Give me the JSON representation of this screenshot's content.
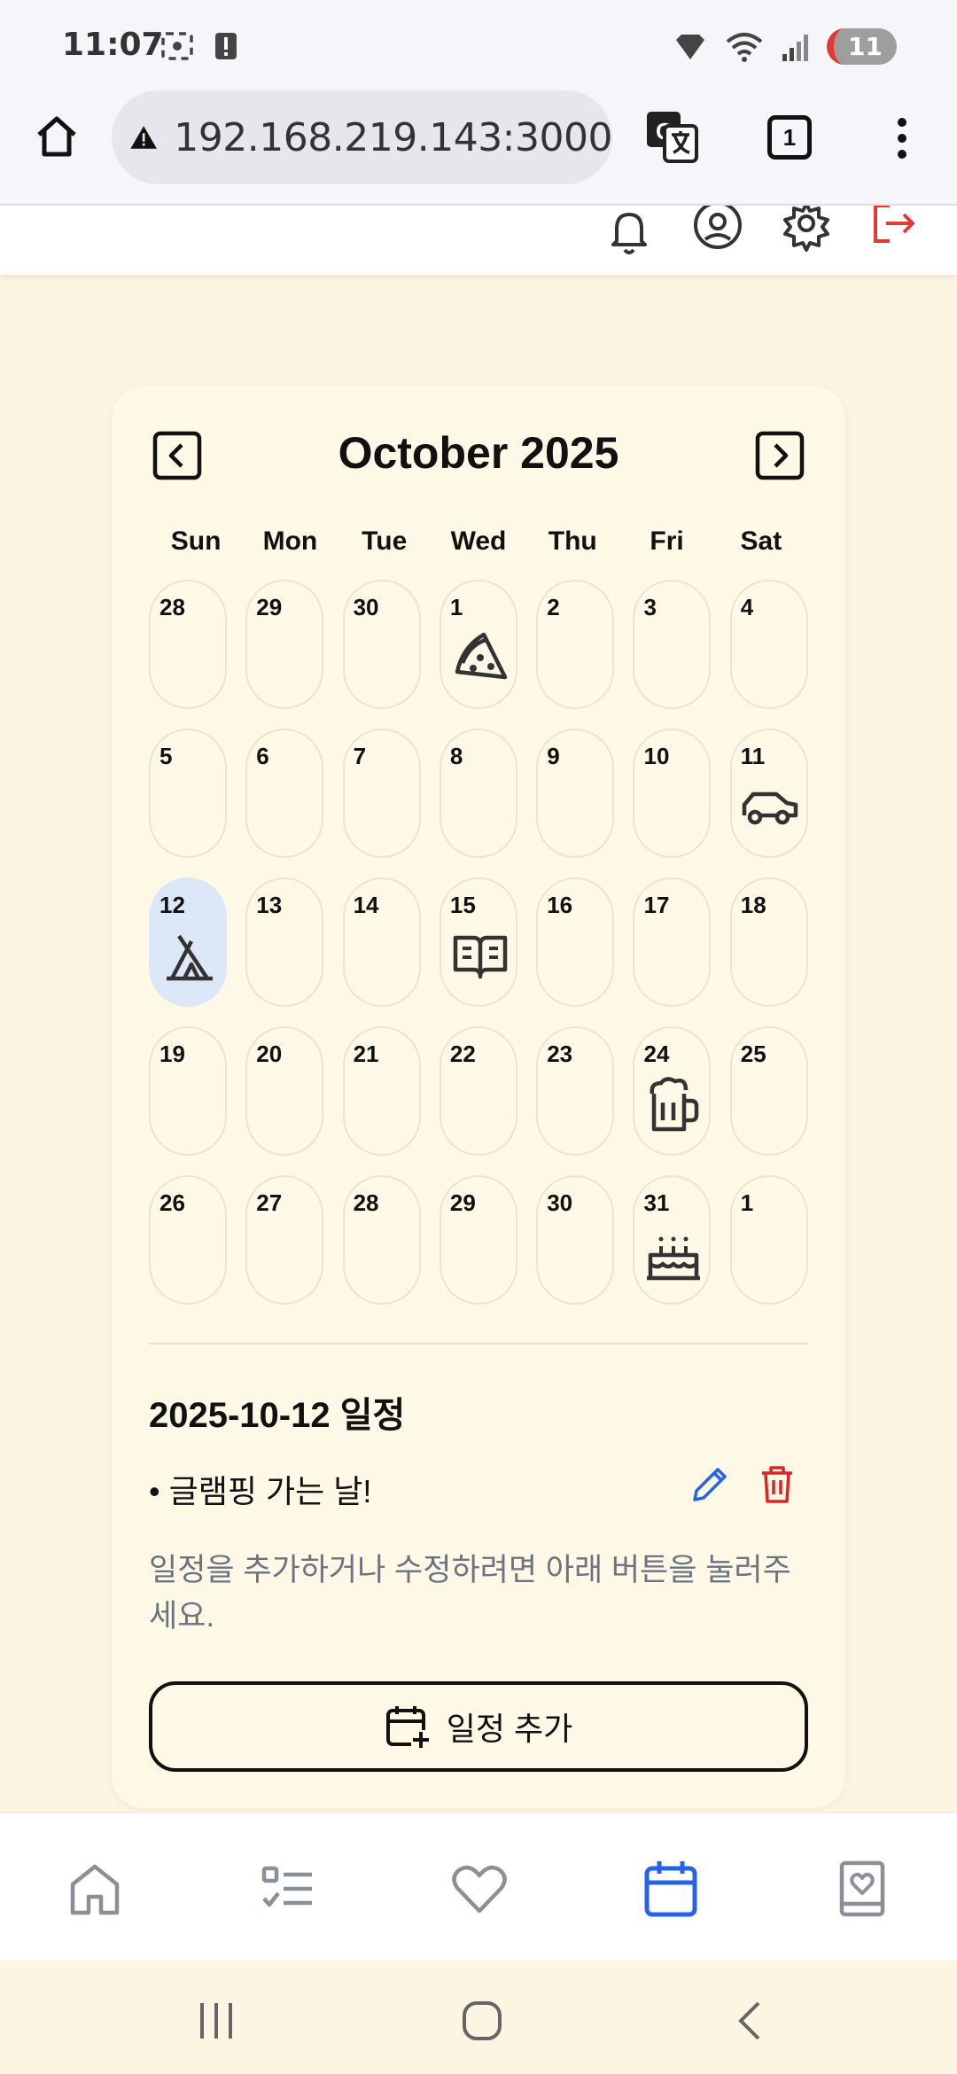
{
  "status_bar": {
    "time": "11:07",
    "notification_count": "11"
  },
  "browser": {
    "url": "192.168.219.143:3000",
    "tab_count": "1"
  },
  "calendar": {
    "month_title": "October 2025",
    "weekdays": [
      "Sun",
      "Mon",
      "Tue",
      "Wed",
      "Thu",
      "Fri",
      "Sat"
    ],
    "days": [
      {
        "num": "28",
        "icon": ""
      },
      {
        "num": "29",
        "icon": ""
      },
      {
        "num": "30",
        "icon": ""
      },
      {
        "num": "1",
        "icon": "pizza-icon"
      },
      {
        "num": "2",
        "icon": ""
      },
      {
        "num": "3",
        "icon": ""
      },
      {
        "num": "4",
        "icon": ""
      },
      {
        "num": "5",
        "icon": ""
      },
      {
        "num": "6",
        "icon": ""
      },
      {
        "num": "7",
        "icon": ""
      },
      {
        "num": "8",
        "icon": ""
      },
      {
        "num": "9",
        "icon": ""
      },
      {
        "num": "10",
        "icon": ""
      },
      {
        "num": "11",
        "icon": "car-icon"
      },
      {
        "num": "12",
        "icon": "tent-icon",
        "selected": true
      },
      {
        "num": "13",
        "icon": ""
      },
      {
        "num": "14",
        "icon": ""
      },
      {
        "num": "15",
        "icon": "book-icon"
      },
      {
        "num": "16",
        "icon": ""
      },
      {
        "num": "17",
        "icon": ""
      },
      {
        "num": "18",
        "icon": ""
      },
      {
        "num": "19",
        "icon": ""
      },
      {
        "num": "20",
        "icon": ""
      },
      {
        "num": "21",
        "icon": ""
      },
      {
        "num": "22",
        "icon": ""
      },
      {
        "num": "23",
        "icon": ""
      },
      {
        "num": "24",
        "icon": "beer-icon"
      },
      {
        "num": "25",
        "icon": ""
      },
      {
        "num": "26",
        "icon": ""
      },
      {
        "num": "27",
        "icon": ""
      },
      {
        "num": "28",
        "icon": ""
      },
      {
        "num": "29",
        "icon": ""
      },
      {
        "num": "30",
        "icon": ""
      },
      {
        "num": "31",
        "icon": "cake-icon"
      },
      {
        "num": "1",
        "icon": ""
      }
    ]
  },
  "schedule": {
    "title": "2025-10-12 일정",
    "events": [
      {
        "text": "• 글램핑 가는 날!"
      }
    ],
    "hint": "일정을 추가하거나 수정하려면 아래 버튼을 눌러주세요.",
    "add_label": "일정 추가"
  },
  "colors": {
    "accent": "#2563EB",
    "danger": "#DC2626",
    "selected_bg": "#DCE8F8",
    "page_bg": "#FCF5E1"
  },
  "bottom_nav": [
    {
      "name": "home-icon"
    },
    {
      "name": "checklist-icon"
    },
    {
      "name": "heart-icon"
    },
    {
      "name": "calendar-icon",
      "active": true
    },
    {
      "name": "album-icon"
    }
  ]
}
